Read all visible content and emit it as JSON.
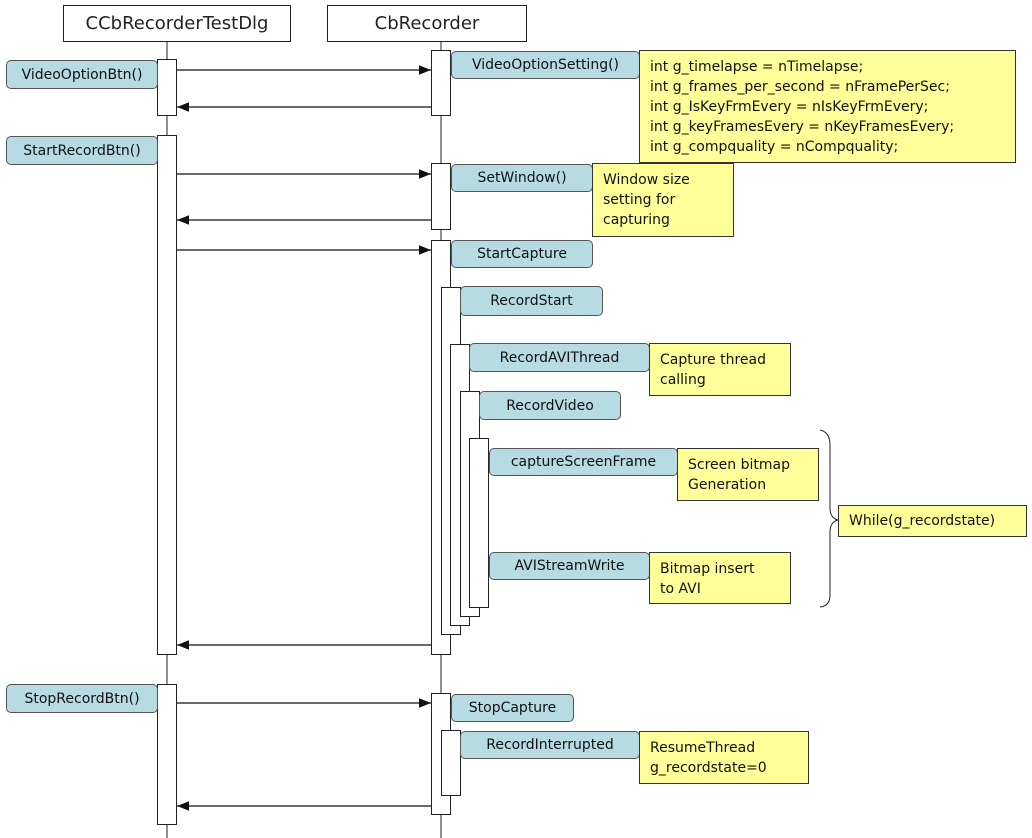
{
  "participants": [
    "CCbRecorderTestDlg",
    "CbRecorder"
  ],
  "caller_labels": [
    "VideoOptionBtn()",
    "StartRecordBtn()",
    "StopRecordBtn()"
  ],
  "callee_labels": [
    "VideoOptionSetting()",
    "SetWindow()",
    "StartCapture",
    "RecordStart",
    "RecordAVIThread",
    "RecordVideo",
    "captureScreenFrame",
    "AVIStreamWrite",
    "StopCapture",
    "RecordInterrupted"
  ],
  "notes": {
    "video_options": "int g_timelapse = nTimelapse;\nint g_frames_per_second = nFramePerSec;\nint g_IsKeyFrmEvery = nIsKeyFrmEvery;\nint g_keyFramesEvery = nKeyFramesEvery;\nint g_compquality = nCompquality;",
    "set_window": "Window size\nsetting for\ncapturing",
    "capture_thread": "Capture thread\ncalling",
    "screen_bitmap": "Screen bitmap\nGeneration",
    "bitmap_insert": "Bitmap insert\nto AVI",
    "loop": "While(g_recordstate)",
    "stop": "ResumeThread\ng_recordstate=0"
  },
  "colors": {
    "label_fill": "#b7dbe2",
    "note_fill": "#ffff9a"
  }
}
